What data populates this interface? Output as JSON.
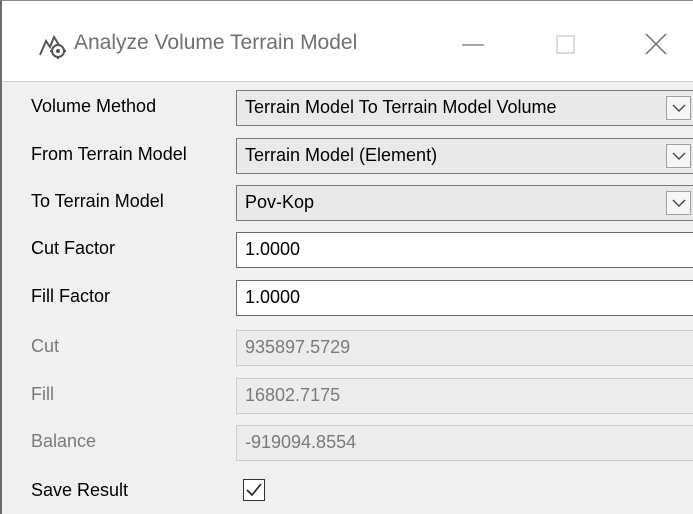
{
  "window": {
    "title": "Analyze Volume Terrain Model",
    "icon": "terrain-tool-icon",
    "controls": [
      "minimize-icon",
      "maximize-icon",
      "close-icon"
    ]
  },
  "form": {
    "volume_method": {
      "label": "Volume Method",
      "value": "Terrain Model To Terrain Model Volume"
    },
    "from_terrain_model": {
      "label": "From Terrain Model",
      "value": "Terrain Model (Element)"
    },
    "to_terrain_model": {
      "label": "To Terrain Model",
      "value": "Pov-Kop"
    },
    "cut_factor": {
      "label": "Cut Factor",
      "value": "1.0000"
    },
    "fill_factor": {
      "label": "Fill Factor",
      "value": "1.0000"
    },
    "cut": {
      "label": "Cut",
      "value": "935897.5729"
    },
    "fill": {
      "label": "Fill",
      "value": "16802.7175"
    },
    "balance": {
      "label": "Balance",
      "value": "-919094.8554"
    },
    "save_result": {
      "label": "Save Result",
      "checked": true
    }
  }
}
